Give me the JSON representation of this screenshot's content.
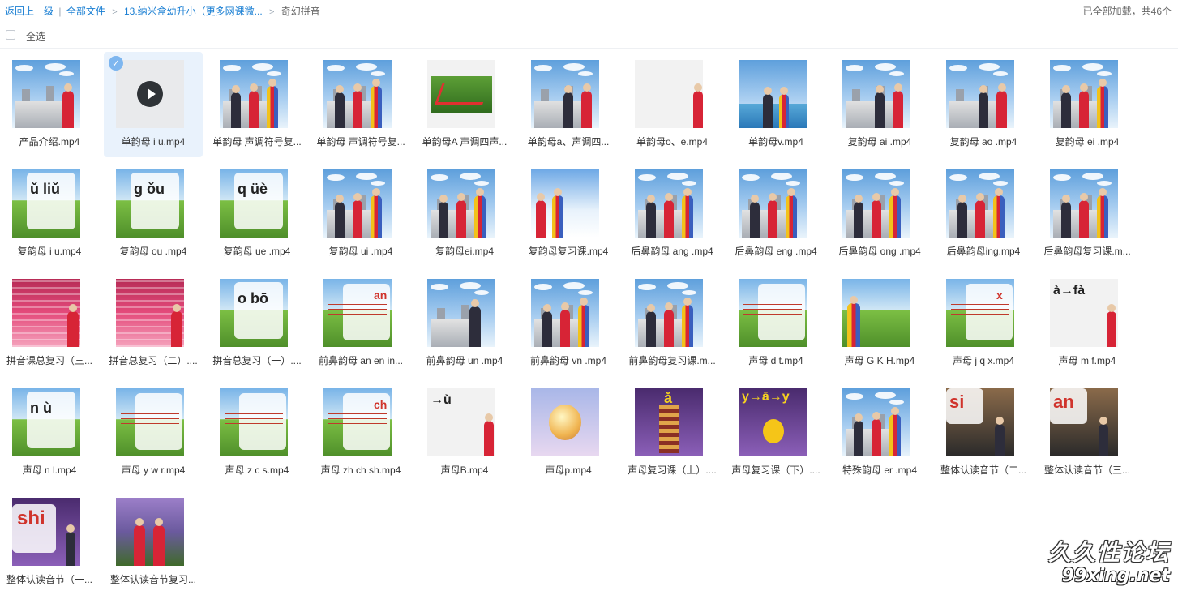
{
  "breadcrumb": {
    "back": "返回上一级",
    "separator": "|",
    "all_files": "全部文件",
    "folder": "13.纳米盒幼升小（更多网课微...",
    "current": "奇幻拼音"
  },
  "status": "已全部加载，共46个",
  "select_all": "全选",
  "files": [
    {
      "name": "产品介绍.mp4",
      "thumb": "castle-red"
    },
    {
      "name": "单韵母 i u.mp4",
      "thumb": "placeholder",
      "selected": true
    },
    {
      "name": "单韵母 声调符号复...",
      "thumb": "castle2"
    },
    {
      "name": "单韵母 声调符号复...",
      "thumb": "castle2"
    },
    {
      "name": "单韵母A 声调四声...",
      "thumb": "slide-green"
    },
    {
      "name": "单韵母a、声调四...",
      "thumb": "castle-two"
    },
    {
      "name": "单韵母o、e.mp4",
      "thumb": "gray-red"
    },
    {
      "name": "单韵母v.mp4",
      "thumb": "lake"
    },
    {
      "name": "复韵母 ai .mp4",
      "thumb": "castle-two"
    },
    {
      "name": "复韵母 ao .mp4",
      "thumb": "castle-two"
    },
    {
      "name": "复韵母 ei .mp4",
      "thumb": "castle-three"
    },
    {
      "name": "复韵母 i u.mp4",
      "thumb": "card-text",
      "text": "ǔ liǔ"
    },
    {
      "name": "复韵母 ou .mp4",
      "thumb": "card-text",
      "text": "g ǒu"
    },
    {
      "name": "复韵母 ue .mp4",
      "thumb": "card-text",
      "text": "q üè"
    },
    {
      "name": "复韵母 ui .mp4",
      "thumb": "castle-three"
    },
    {
      "name": "复韵母ei.mp4",
      "thumb": "castle-three"
    },
    {
      "name": "复韵母复习课.mp4",
      "thumb": "snow"
    },
    {
      "name": "后鼻韵母 ang .mp4",
      "thumb": "castle-three"
    },
    {
      "name": "后鼻韵母 eng .mp4",
      "thumb": "castle-three"
    },
    {
      "name": "后鼻韵母 ong .mp4",
      "thumb": "castle-three"
    },
    {
      "name": "后鼻韵母ing.mp4",
      "thumb": "castle-three"
    },
    {
      "name": "后鼻韵母复习课.m...",
      "thumb": "castle-three"
    },
    {
      "name": "拼音课总复习（三...",
      "thumb": "stairs"
    },
    {
      "name": "拼音总复习（二）....",
      "thumb": "stairs"
    },
    {
      "name": "拼音总复习（一）....",
      "thumb": "card-text",
      "text": "o bō"
    },
    {
      "name": "前鼻韵母 an en in...",
      "thumb": "card-lines",
      "text": "an"
    },
    {
      "name": "前鼻韵母 un .mp4",
      "thumb": "castle-dark"
    },
    {
      "name": "前鼻韵母 vn .mp4",
      "thumb": "castle-three"
    },
    {
      "name": "前鼻韵母复习课.m...",
      "thumb": "castle-three"
    },
    {
      "name": "声母 d t.mp4",
      "thumb": "card-lines",
      "text": ""
    },
    {
      "name": "声母 G K H.mp4",
      "thumb": "field"
    },
    {
      "name": "声母 j q x.mp4",
      "thumb": "card-lines",
      "text": "x"
    },
    {
      "name": "声母 m f.mp4",
      "thumb": "gray-text",
      "text": "à→fà"
    },
    {
      "name": "声母 n l.mp4",
      "thumb": "card-text",
      "text": "n ù"
    },
    {
      "name": "声母 y w r.mp4",
      "thumb": "card-lines",
      "text": ""
    },
    {
      "name": "声母 z c s.mp4",
      "thumb": "card-lines",
      "text": ""
    },
    {
      "name": "声母 zh ch sh.mp4",
      "thumb": "card-lines",
      "text": "ch"
    },
    {
      "name": "声母B.mp4",
      "thumb": "gray-text",
      "text": "→ù"
    },
    {
      "name": "声母p.mp4",
      "thumb": "lantern"
    },
    {
      "name": "声母复习课（上）....",
      "thumb": "pagoda",
      "text": "ǎ"
    },
    {
      "name": "声母复习课（下）....",
      "thumb": "chick",
      "text": "y→ā→y"
    },
    {
      "name": "特殊韵母 er .mp4",
      "thumb": "castle-three"
    },
    {
      "name": "整体认读音节（二...",
      "thumb": "dark-text",
      "text": "si"
    },
    {
      "name": "整体认读音节（三...",
      "thumb": "dark-text",
      "text": "an"
    },
    {
      "name": "整体认读音节（一...",
      "thumb": "purple-text",
      "text": "shi"
    },
    {
      "name": "整体认读音节复习...",
      "thumb": "forest"
    }
  ],
  "watermark": {
    "title": "久久性论坛",
    "url": "99xing.net"
  }
}
